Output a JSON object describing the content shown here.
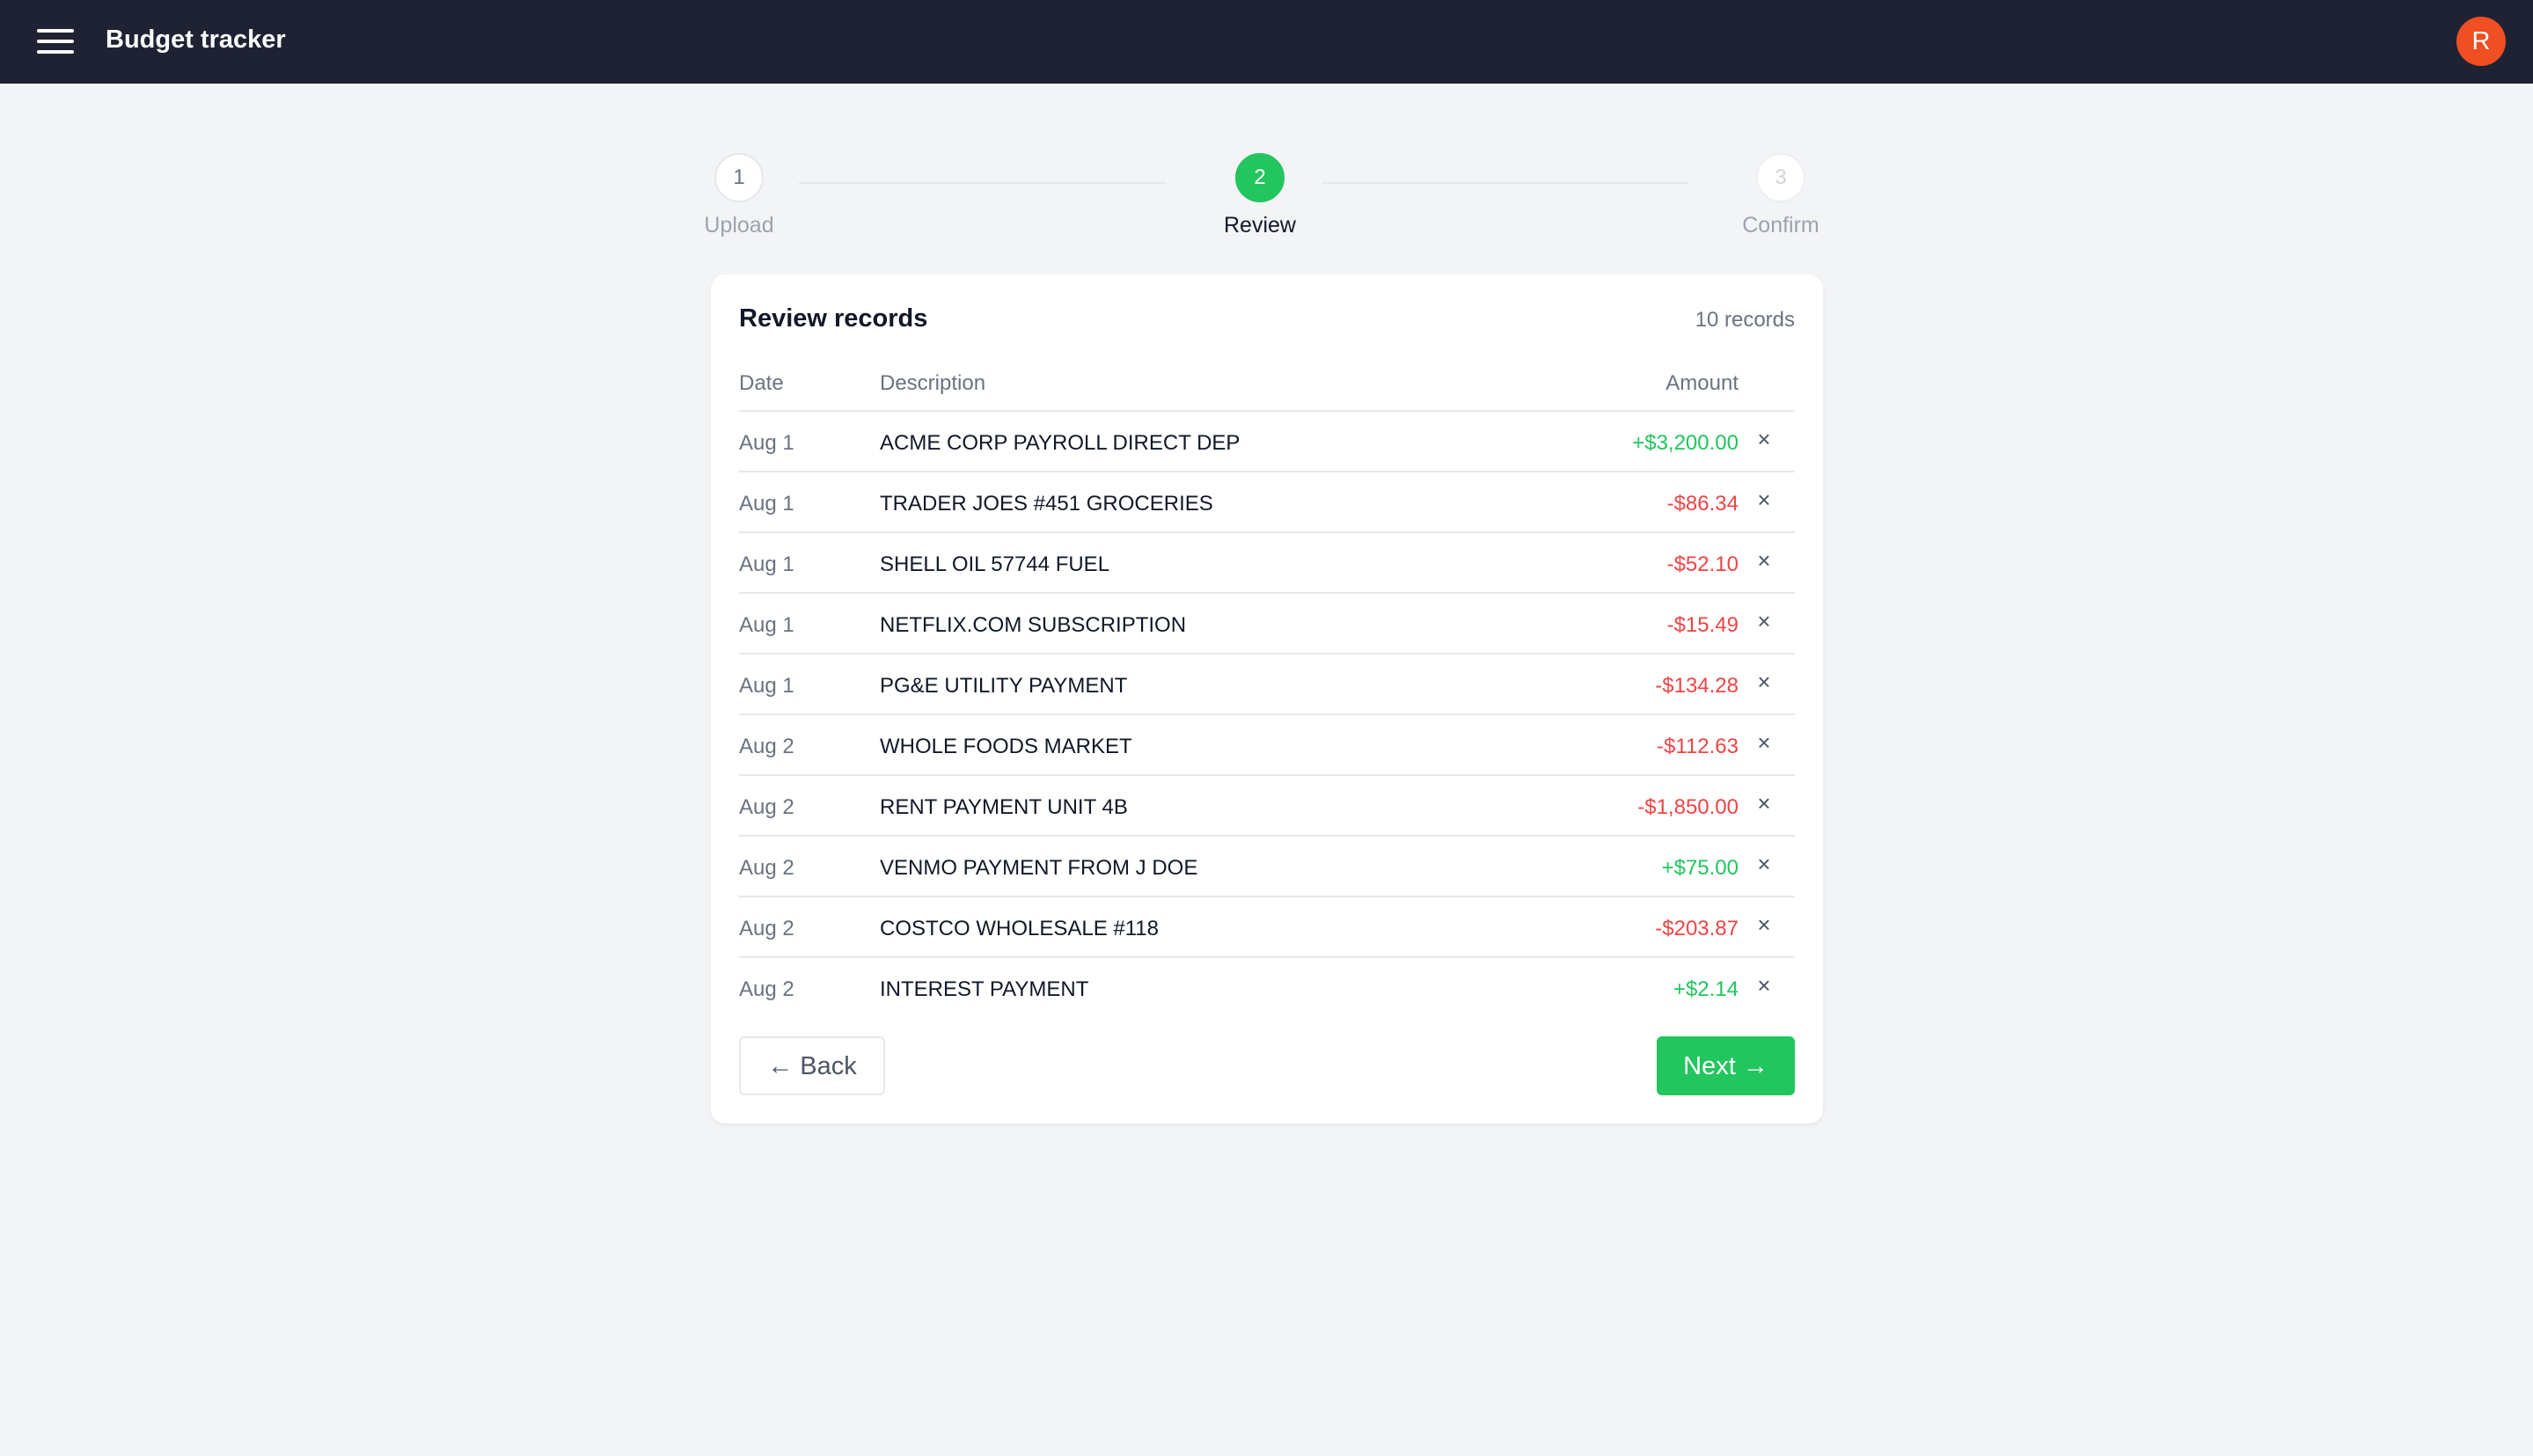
{
  "app": {
    "title": "Budget tracker",
    "avatar_initial": "R"
  },
  "stepper": {
    "steps": [
      {
        "number": "1",
        "label": "Upload",
        "state": "done"
      },
      {
        "number": "2",
        "label": "Review",
        "state": "active"
      },
      {
        "number": "3",
        "label": "Confirm",
        "state": "future"
      }
    ]
  },
  "review": {
    "title": "Review records",
    "count_label": "10 records",
    "columns": {
      "date": "Date",
      "description": "Description",
      "amount": "Amount"
    },
    "remove_glyph": "×",
    "rows": [
      {
        "date": "Aug 1",
        "description": "ACME CORP PAYROLL DIRECT DEP",
        "amount": "+$3,200.00",
        "sign": "pos"
      },
      {
        "date": "Aug 1",
        "description": "TRADER JOES #451 GROCERIES",
        "amount": "-$86.34",
        "sign": "neg"
      },
      {
        "date": "Aug 1",
        "description": "SHELL OIL 57744 FUEL",
        "amount": "-$52.10",
        "sign": "neg"
      },
      {
        "date": "Aug 1",
        "description": "NETFLIX.COM SUBSCRIPTION",
        "amount": "-$15.49",
        "sign": "neg"
      },
      {
        "date": "Aug 1",
        "description": "PG&E UTILITY PAYMENT",
        "amount": "-$134.28",
        "sign": "neg"
      },
      {
        "date": "Aug 2",
        "description": "WHOLE FOODS MARKET",
        "amount": "-$112.63",
        "sign": "neg"
      },
      {
        "date": "Aug 2",
        "description": "RENT PAYMENT UNIT 4B",
        "amount": "-$1,850.00",
        "sign": "neg"
      },
      {
        "date": "Aug 2",
        "description": "VENMO PAYMENT FROM J DOE",
        "amount": "+$75.00",
        "sign": "pos"
      },
      {
        "date": "Aug 2",
        "description": "COSTCO WHOLESALE #118",
        "amount": "-$203.87",
        "sign": "neg"
      },
      {
        "date": "Aug 2",
        "description": "INTEREST PAYMENT",
        "amount": "+$2.14",
        "sign": "pos"
      }
    ]
  },
  "actions": {
    "back_label": "← Back",
    "next_label": "Next →"
  },
  "colors": {
    "topbar": "#1f2233",
    "accent": "#22c55e",
    "negative": "#ef4444",
    "avatar": "#f04e23"
  },
  "icons": {
    "menu": "hamburger-menu-icon",
    "remove": "close-icon"
  }
}
